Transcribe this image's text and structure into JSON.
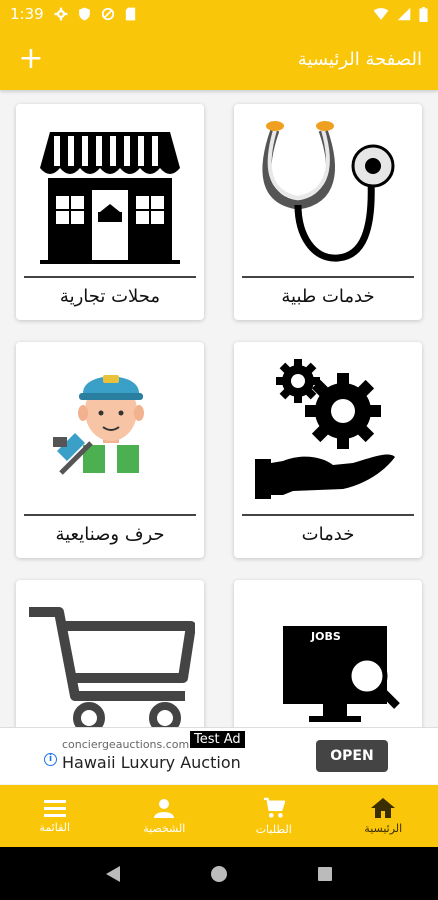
{
  "status_bar": {
    "time": "1:39",
    "icons": [
      "gear-icon",
      "shield-icon",
      "data-saver-icon",
      "sd-card-icon",
      "wifi-icon",
      "signal-icon",
      "battery-icon"
    ]
  },
  "app_bar": {
    "title": "الصفحة الرئيسية",
    "add_icon": "+"
  },
  "categories": [
    {
      "label": "خدمات طبية",
      "icon": "stethoscope-icon"
    },
    {
      "label": "محلات تجارية",
      "icon": "store-icon"
    },
    {
      "label": "خدمات",
      "icon": "gears-hand-icon"
    },
    {
      "label": "حرف وصنايعية",
      "icon": "worker-icon"
    },
    {
      "label": "",
      "icon": "jobs-monitor-icon",
      "screen_text": "JOBS"
    },
    {
      "label": "",
      "icon": "shopping-cart-icon"
    }
  ],
  "ad": {
    "url": "conciergeauctions.com",
    "tag": "Test Ad",
    "title": "Hawaii Luxury Auction",
    "cta": "OPEN"
  },
  "bottom_nav": [
    {
      "label": "القائمة",
      "icon": "menu-icon"
    },
    {
      "label": "الشخصية",
      "icon": "person-icon"
    },
    {
      "label": "الطلبات",
      "icon": "cart-icon"
    },
    {
      "label": "الرئيسية",
      "icon": "home-icon",
      "active": true
    }
  ],
  "colors": {
    "primary": "#f9c60a",
    "active_nav": "#3a2e00"
  }
}
